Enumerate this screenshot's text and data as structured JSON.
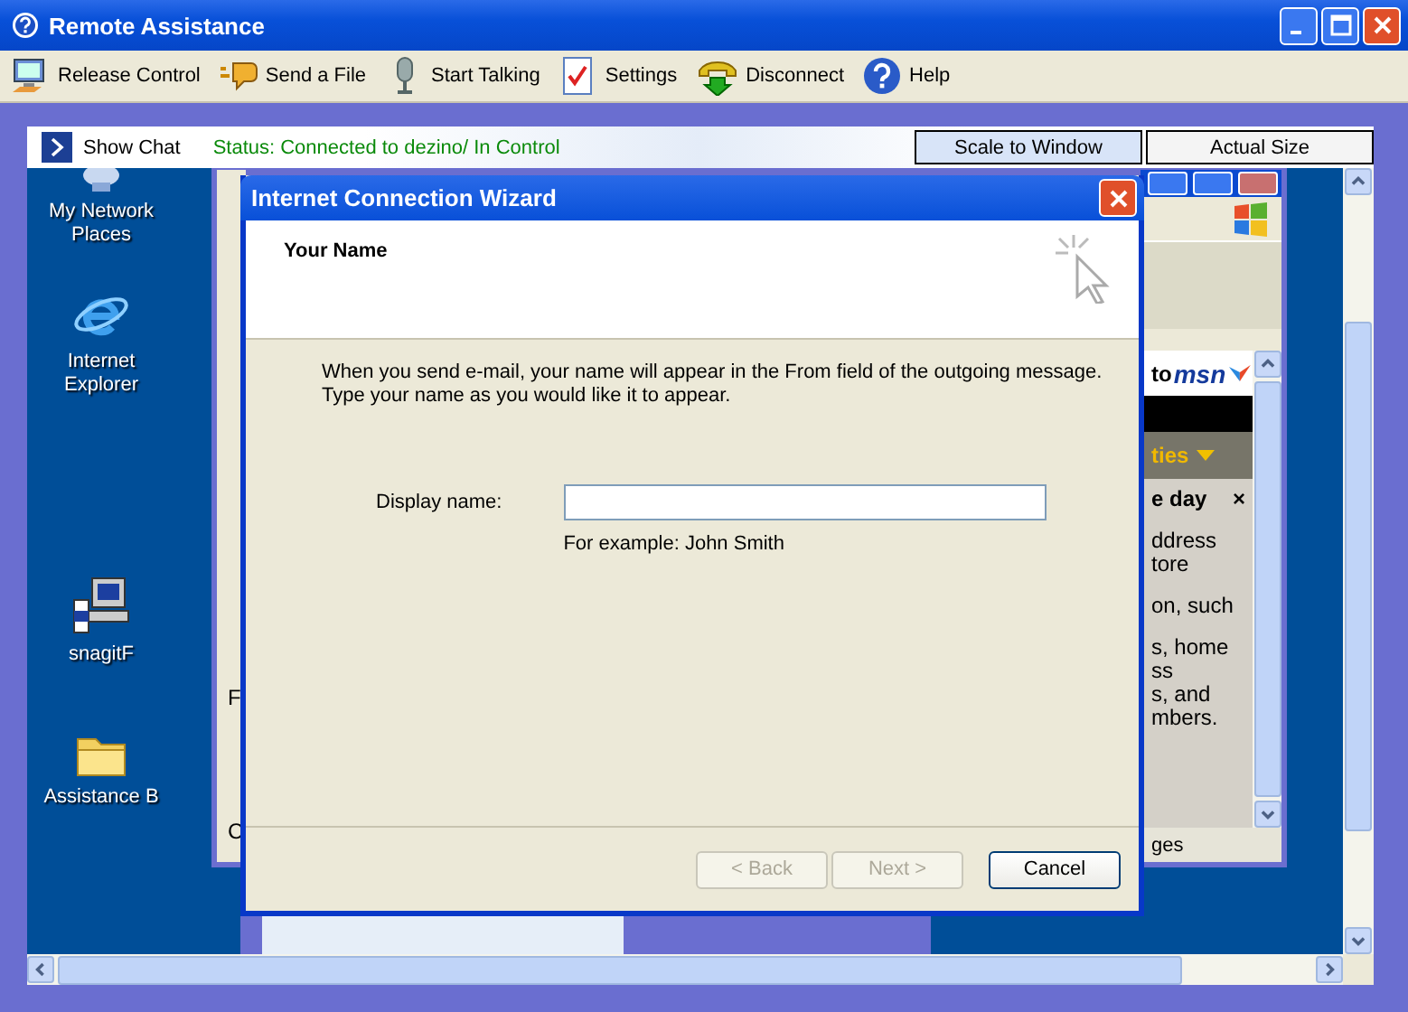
{
  "window": {
    "title": "Remote Assistance"
  },
  "toolbar": [
    {
      "label": "Release Control",
      "kind": "release"
    },
    {
      "label": "Send a File",
      "kind": "file"
    },
    {
      "label": "Start Talking",
      "kind": "talk"
    },
    {
      "label": "Settings",
      "kind": "settings"
    },
    {
      "label": "Disconnect",
      "kind": "disconnect"
    },
    {
      "label": "Help",
      "kind": "help"
    }
  ],
  "chat_bar": {
    "show_chat": "Show Chat",
    "status": "Status: Connected to dezino/ In Control",
    "view_buttons": [
      {
        "label": "Scale to Window",
        "selected": true
      },
      {
        "label": "Actual Size",
        "selected": false
      }
    ]
  },
  "desktop_icons": [
    {
      "label": "My Network Places",
      "kind": "network"
    },
    {
      "label": "Internet Explorer",
      "kind": "ie"
    },
    {
      "label": "snagitF",
      "kind": "setup"
    },
    {
      "label": "Assistance B",
      "kind": "folder"
    }
  ],
  "browser_window": {
    "left_fragments": [
      "F",
      "C"
    ],
    "msn_prefix": "to",
    "msn_logo": "msn",
    "menu_fragment": "ties",
    "panel_title": "e day",
    "panel_close": "×",
    "panel_paragraphs": [
      [
        "ddress",
        "tore"
      ],
      [
        "on, such"
      ],
      [
        "s, home",
        "ss",
        "s, and",
        "mbers."
      ]
    ],
    "status_fragment": "ges"
  },
  "wizard": {
    "title": "Internet Connection Wizard",
    "heading": "Your Name",
    "intro": [
      "When you send e-mail, your name will appear in the From field of the outgoing message.",
      "Type your name as you would like it to appear."
    ],
    "field_label": "Display name:",
    "example": "For example: John Smith",
    "buttons": [
      {
        "label": "< Back",
        "disabled": true
      },
      {
        "label": "Next >",
        "disabled": true
      },
      {
        "label": "Cancel",
        "disabled": false
      }
    ]
  }
}
